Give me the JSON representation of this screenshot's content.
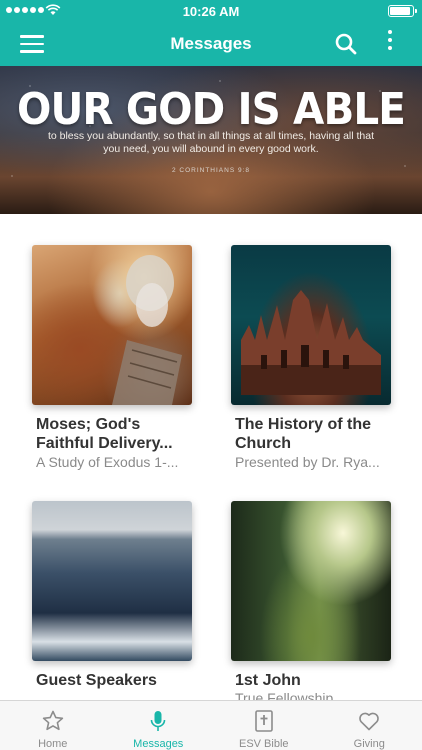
{
  "status_bar": {
    "time": "10:26 AM"
  },
  "header": {
    "title": "Messages"
  },
  "banner": {
    "headline": "OUR GOD IS ABLE",
    "verse": "to bless you abundantly, so that in all things at all times, having all that you need, you will abound in every good work.",
    "reference": "2 CORINTHIANS 9:8"
  },
  "series": [
    {
      "title": "Moses; God's Faithful Delivery...",
      "subtitle": "A Study of Exodus 1-..."
    },
    {
      "title": "The History of the Church",
      "subtitle": "Presented by Dr. Rya..."
    },
    {
      "title": "Guest Speakers",
      "subtitle": ""
    },
    {
      "title": "1st John",
      "subtitle": "True Fellowship"
    }
  ],
  "tabs": [
    {
      "label": "Home",
      "icon": "star-icon"
    },
    {
      "label": "Messages",
      "icon": "microphone-icon",
      "active": true
    },
    {
      "label": "ESV Bible",
      "icon": "bible-icon"
    },
    {
      "label": "Giving",
      "icon": "heart-icon"
    }
  ],
  "colors": {
    "accent": "#19b6a9",
    "tab_inactive": "#8c8c8c"
  }
}
